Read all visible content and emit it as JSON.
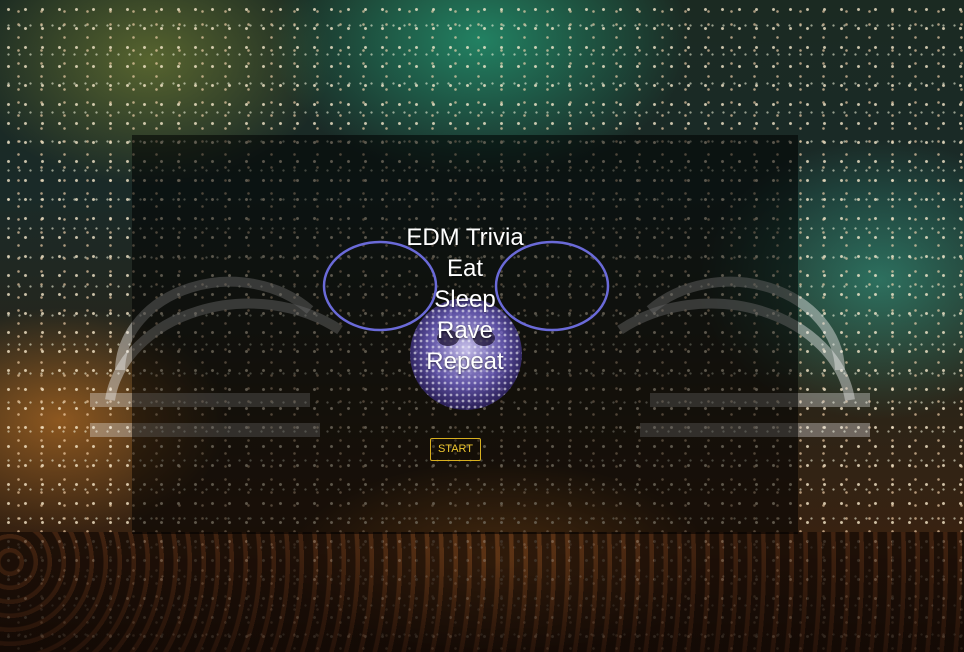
{
  "hero": {
    "title_lines": [
      "EDM Trivia",
      "Eat",
      "Sleep",
      "Rave",
      "Repeat"
    ]
  },
  "controls": {
    "start_label": "START"
  },
  "icons": {
    "mascot": "deadmau5-head-icon"
  },
  "colors": {
    "panel_overlay": "#000000",
    "title_text": "#ffffff",
    "start_button_border": "#d8b020",
    "start_button_text": "#f0c830",
    "mascot_outline": "#6a6ad8"
  }
}
